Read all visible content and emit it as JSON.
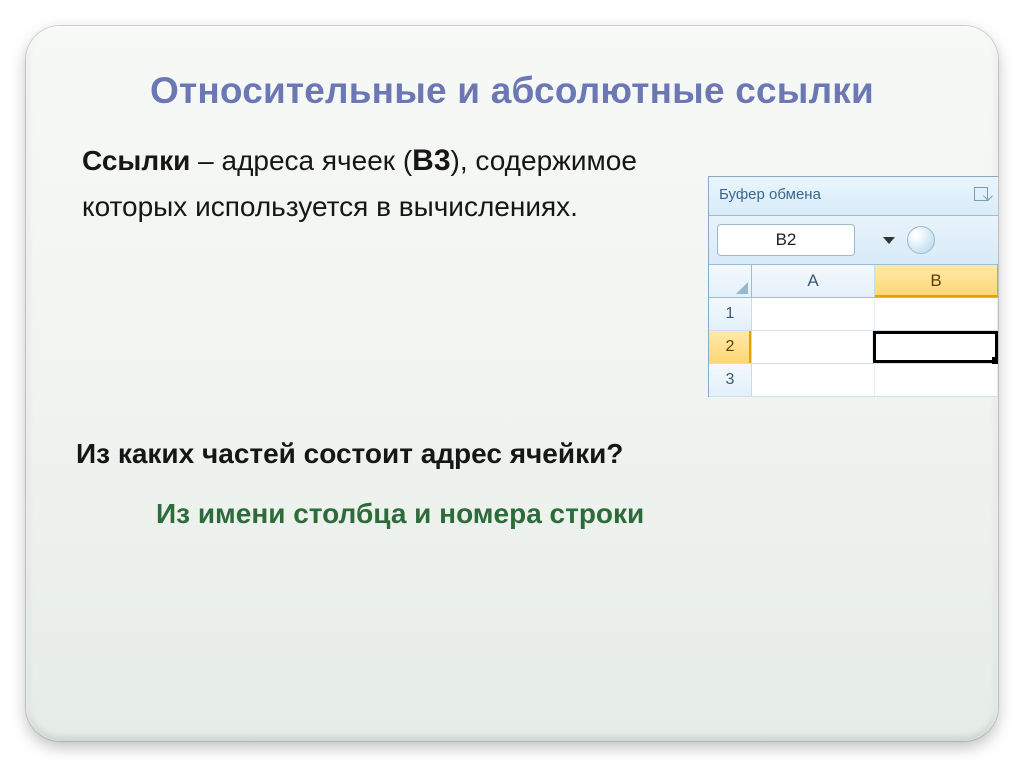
{
  "title": "Относительные и абсолютные ссылки",
  "para_lead": "Ссылки",
  "para_mid1": " – адреса ячеек (",
  "para_cellref": "В3",
  "para_mid2": "), содержимое которых используется в вычислениях.",
  "question": "Из каких частей состоит адрес ячейки?",
  "answer": "Из имени столбца и номера строки",
  "excel": {
    "clipboard": "Буфер обмена",
    "name_box": "B2",
    "cols": [
      "A",
      "B"
    ],
    "rows": [
      "1",
      "2",
      "3"
    ]
  }
}
